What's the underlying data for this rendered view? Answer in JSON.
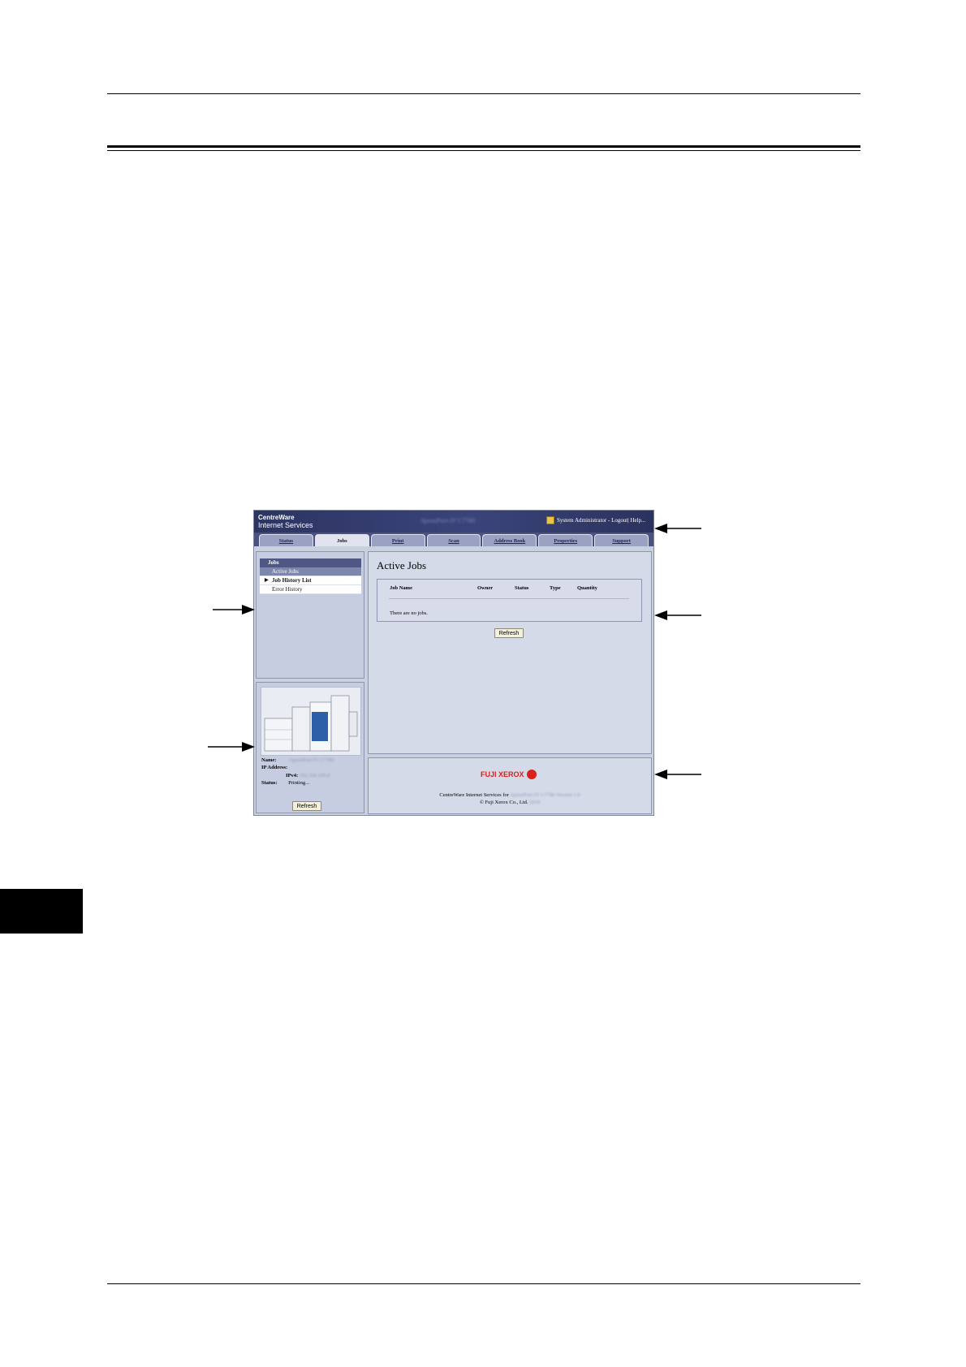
{
  "shot": {
    "brand_line1": "CentreWare",
    "brand_line2": "Internet Services",
    "device_name": "ApeosPort-IV C7780",
    "admin_text": "System Administrator - Logout| Help...",
    "tabs": [
      {
        "label": "Status"
      },
      {
        "label": "Jobs"
      },
      {
        "label": "Print"
      },
      {
        "label": "Scan"
      },
      {
        "label": "Address Book"
      },
      {
        "label": "Properties"
      },
      {
        "label": "Support"
      }
    ],
    "nav": {
      "heading": "Jobs",
      "items": [
        "Active Jobs",
        "Job History List",
        "Error History"
      ]
    },
    "content": {
      "title": "Active Jobs",
      "columns": [
        "Job Name",
        "Owner",
        "Status",
        "Type",
        "Quantity"
      ],
      "empty_text": "There are no jobs.",
      "refresh_label": "Refresh"
    },
    "device": {
      "name_label": "Name:",
      "name_value": "ApeosPort-IV C7780",
      "ip_label": "IP Address:",
      "ipv4_label": "IPv4:",
      "ipv4_value": "192.168.100.4",
      "status_label": "Status:",
      "status_value": "Printing...",
      "refresh_label": "Refresh"
    },
    "footer": {
      "logo_text": "FUJI XEROX",
      "line1_prefix": "CentreWare Internet Services for",
      "line1_blurred": "ApeosPort-IV C7780 Version 1.0",
      "line2_prefix": "© Fuji Xerox Co., Ltd.",
      "line2_blurred": "2010"
    }
  }
}
